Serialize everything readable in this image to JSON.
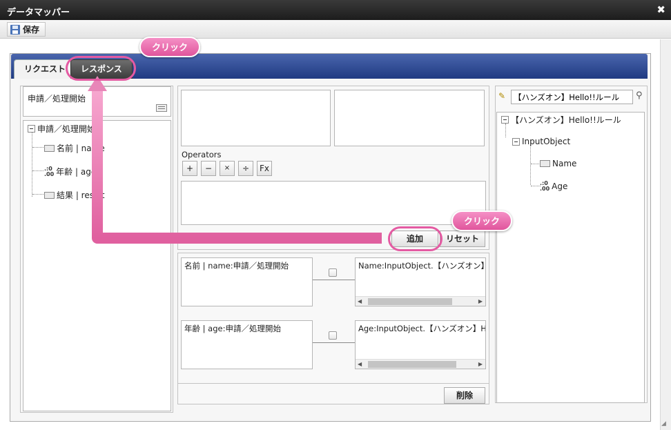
{
  "window": {
    "title": "データマッパー"
  },
  "toolbar": {
    "save_label": "保存"
  },
  "tabs": [
    {
      "label": "リクエスト",
      "active": true
    },
    {
      "label": "レスポンス",
      "active": false
    }
  ],
  "left": {
    "header": "申請／処理開始",
    "tree": {
      "root": "申請／処理開始",
      "items": [
        {
          "label": "名前 | name",
          "icon": "field-icon"
        },
        {
          "label": "年齢 | age",
          "icon": "number-icon"
        },
        {
          "label": "結果 | result",
          "icon": "field-icon"
        }
      ]
    }
  },
  "middle": {
    "operators_label": "Operators",
    "operators": [
      "+",
      "−",
      "×",
      "÷",
      "Fx"
    ],
    "add_label": "追加",
    "reset_label": "リセット",
    "delete_label": "削除",
    "mappings": [
      {
        "source": "名前 | name:申請／処理開始",
        "target": "Name:InputObject.【ハンズオン】Hello!!ルール"
      },
      {
        "source": "年齢 | age:申請／処理開始",
        "target": "Age:InputObject.【ハンズオン】Hello!!ルール"
      }
    ]
  },
  "right": {
    "search_value": "【ハンズオン】Hello!!ルール",
    "tree": {
      "root": "【ハンズオン】Hello!!ルール",
      "object": "InputObject",
      "items": [
        {
          "label": "Name",
          "icon": "field-icon"
        },
        {
          "label": "Age",
          "icon": "number-icon"
        }
      ]
    }
  },
  "callouts": {
    "tab_click": "クリック",
    "add_click": "クリック"
  },
  "colors": {
    "callout": "#e8549c",
    "tabstrip": "#2b4690",
    "titlebar": "#2a2a2a"
  }
}
